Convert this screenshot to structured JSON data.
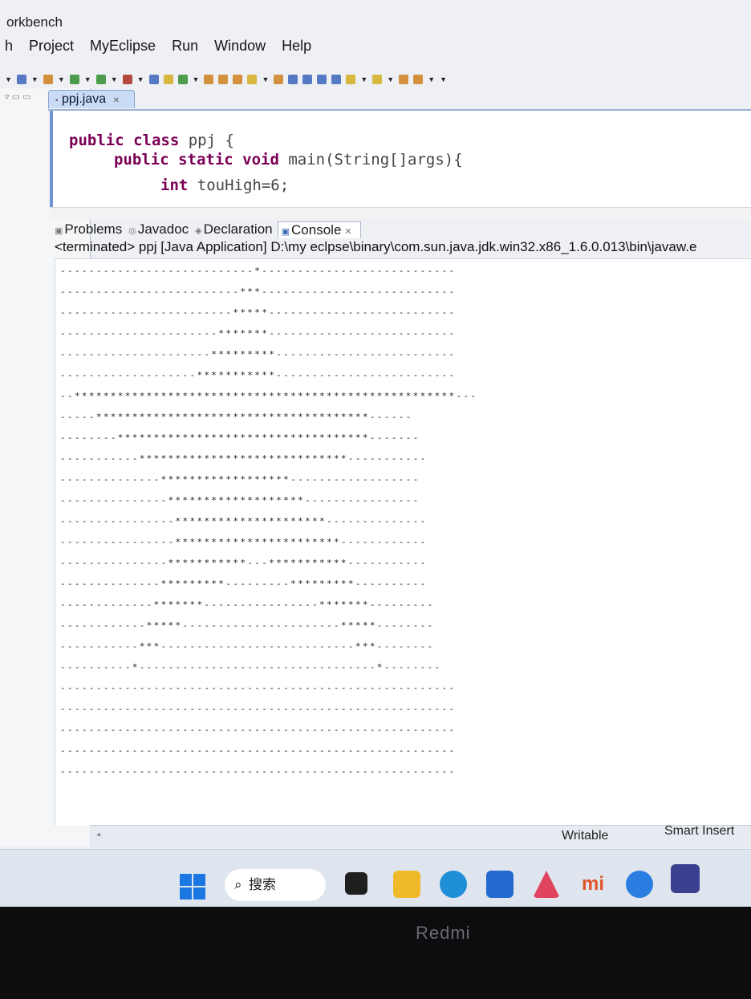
{
  "window": {
    "title": "orkbench"
  },
  "menubar": {
    "items": [
      "h",
      "Project",
      "MyEclipse",
      "Run",
      "Window",
      "Help"
    ]
  },
  "editor": {
    "tab_label": "ppj.java",
    "code": {
      "line1_kw": "public class",
      "line1_rest": " ppj {",
      "line2_kw": "public static void",
      "line2_rest": " main(String[]args){",
      "line3_kw": "int",
      "line3_rest": " touHigh=6;"
    }
  },
  "views": {
    "tabs": [
      {
        "label": "Problems",
        "icon": "problems-icon"
      },
      {
        "label": "Javadoc",
        "icon": "javadoc-icon"
      },
      {
        "label": "Declaration",
        "icon": "declaration-icon"
      },
      {
        "label": "Console",
        "icon": "console-icon"
      }
    ],
    "console_header": "<terminated> ppj [Java Application] D:\\my eclpse\\binary\\com.sun.java.jdk.win32.x86_1.6.0.013\\bin\\javaw.e"
  },
  "console_lines": [
    "---------------------------*---------------------------",
    "-------------------------***---------------------------",
    "------------------------*****--------------------------",
    "----------------------*******--------------------------",
    "---------------------*********-------------------------",
    "-------------------***********-------------------------",
    "--*****************************************************---",
    "-----**************************************------",
    "--------***********************************-------",
    "-----------*****************************-----------",
    "--------------******************------------------",
    "---------------*******************----------------",
    "----------------*********************--------------",
    "----------------***********************------------",
    "---------------***********---***********-----------",
    "--------------*********---------*********----------",
    "-------------*******----------------*******---------",
    "------------*****----------------------*****--------",
    "-----------***---------------------------***--------",
    "----------*---------------------------------*--------",
    "-------------------------------------------------------",
    "-------------------------------------------------------",
    "-------------------------------------------------------",
    "-------------------------------------------------------",
    "-------------------------------------------------------"
  ],
  "statusbar": {
    "writable": "Writable",
    "insert_mode": "Smart Insert"
  },
  "taskbar": {
    "search_label": "搜索"
  },
  "device": {
    "brand": "Redmi"
  },
  "colors": {
    "keyword": "#7a0055",
    "accent": "#1b78e2"
  }
}
